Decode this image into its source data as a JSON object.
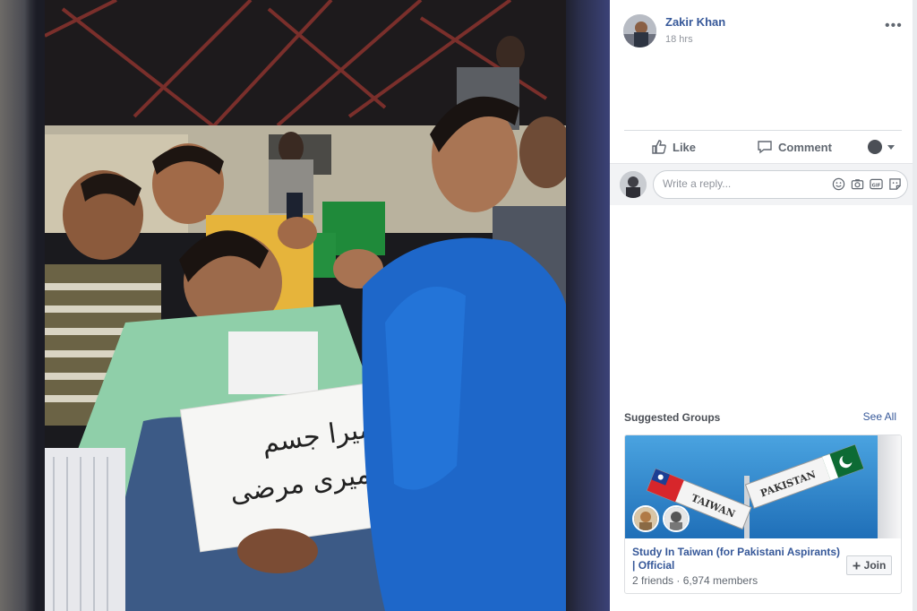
{
  "post": {
    "author": "Zakir Khan",
    "timestamp": "18 hrs",
    "more_label": "•••"
  },
  "actions": {
    "like": "Like",
    "comment": "Comment"
  },
  "reply": {
    "placeholder": "Write a reply..."
  },
  "icons": {
    "like": "thumbs-up-icon",
    "comment": "speech-bubble-icon",
    "emoji": "smiley-icon",
    "camera": "camera-icon",
    "gif": "gif-icon",
    "sticker": "sticker-icon",
    "join": "plus-icon"
  },
  "photo": {
    "sign_text": "میرا جسم میری مرضی"
  },
  "suggested": {
    "title": "Suggested Groups",
    "see_all": "See All",
    "group": {
      "cover_sign_left": "TAIWAN",
      "cover_sign_right": "PAKISTAN",
      "name": "Study In Taiwan (for Pakistani Aspirants) | Official",
      "meta": "2 friends · 6,974 members",
      "join_label": "Join"
    }
  },
  "colors": {
    "link": "#365899",
    "muted": "#90949c",
    "action": "#606770",
    "panel_bg": "#ffffff"
  }
}
